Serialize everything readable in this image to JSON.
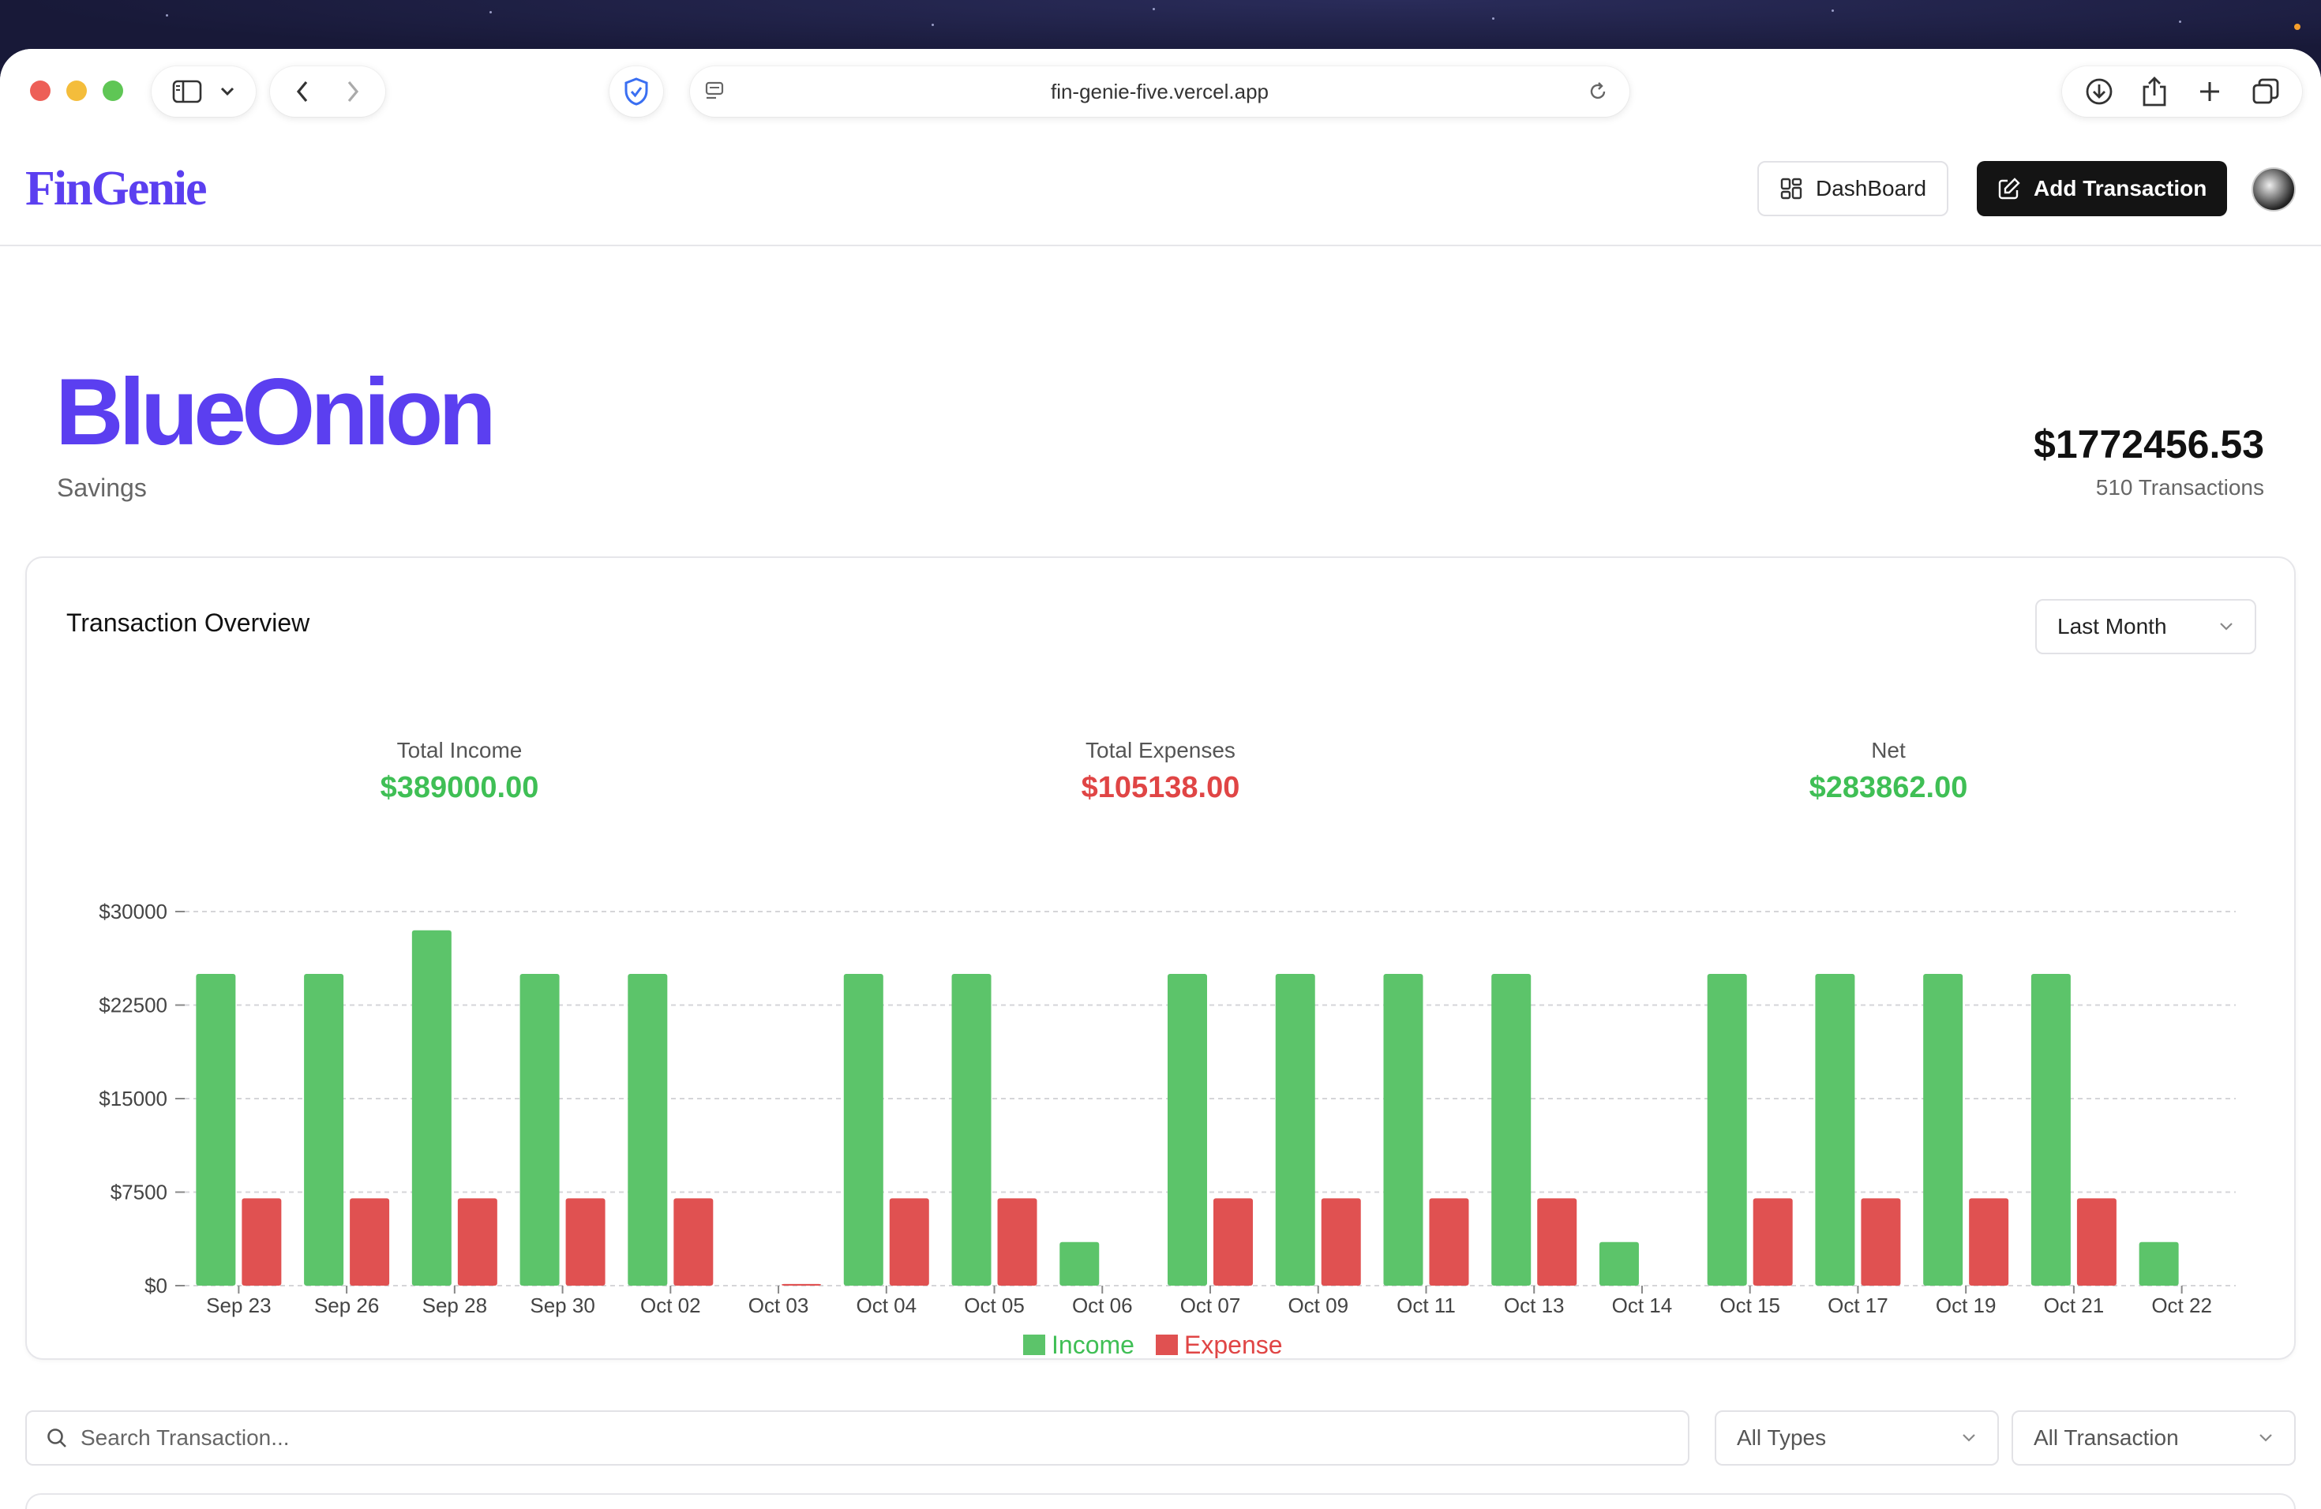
{
  "browser": {
    "url": "fin-genie-five.vercel.app"
  },
  "app": {
    "brand": "FinGenie",
    "dashboard_label": "DashBoard",
    "add_transaction_label": "Add Transaction"
  },
  "account": {
    "name": "BlueOnion",
    "type": "Savings",
    "balance": "$1772456.53",
    "transaction_count": "510 Transactions"
  },
  "overview": {
    "title": "Transaction Overview",
    "range_select": "Last Month",
    "stats": {
      "income_label": "Total Income",
      "income_value": "$389000.00",
      "expenses_label": "Total Expenses",
      "expenses_value": "$105138.00",
      "net_label": "Net",
      "net_value": "$283862.00"
    }
  },
  "colors": {
    "brand": "#5b3ff0",
    "income": "#5cc46a",
    "expense": "#e05151",
    "income_text": "#3fbf55",
    "expense_text": "#e04545"
  },
  "chart_data": {
    "type": "bar",
    "categories": [
      "Sep 23",
      "Sep 26",
      "Sep 28",
      "Sep 30",
      "Oct 02",
      "Oct 03",
      "Oct 04",
      "Oct 05",
      "Oct 06",
      "Oct 07",
      "Oct 09",
      "Oct 11",
      "Oct 13",
      "Oct 14",
      "Oct 15",
      "Oct 17",
      "Oct 19",
      "Oct 21",
      "Oct 22"
    ],
    "series": [
      {
        "name": "Income",
        "color": "#5cc46a",
        "values": [
          25000,
          25000,
          28500,
          25000,
          25000,
          0,
          25000,
          25000,
          3500,
          25000,
          25000,
          25000,
          25000,
          3500,
          25000,
          25000,
          25000,
          25000,
          3500
        ]
      },
      {
        "name": "Expense",
        "color": "#e05151",
        "values": [
          7000,
          7000,
          7000,
          7000,
          7000,
          138,
          7000,
          7000,
          0,
          7000,
          7000,
          7000,
          7000,
          0,
          7000,
          7000,
          7000,
          7000,
          0
        ]
      }
    ],
    "ylim": [
      0,
      30000
    ],
    "yticks": [
      0,
      7500,
      15000,
      22500,
      30000
    ],
    "ytick_labels": [
      "$0",
      "$7500",
      "$15000",
      "$22500",
      "$30000"
    ],
    "grid": true,
    "legend_position": "bottom-center"
  },
  "filters": {
    "search_placeholder": "Search Transaction...",
    "type_select": "All Types",
    "transaction_select": "All Transaction"
  }
}
